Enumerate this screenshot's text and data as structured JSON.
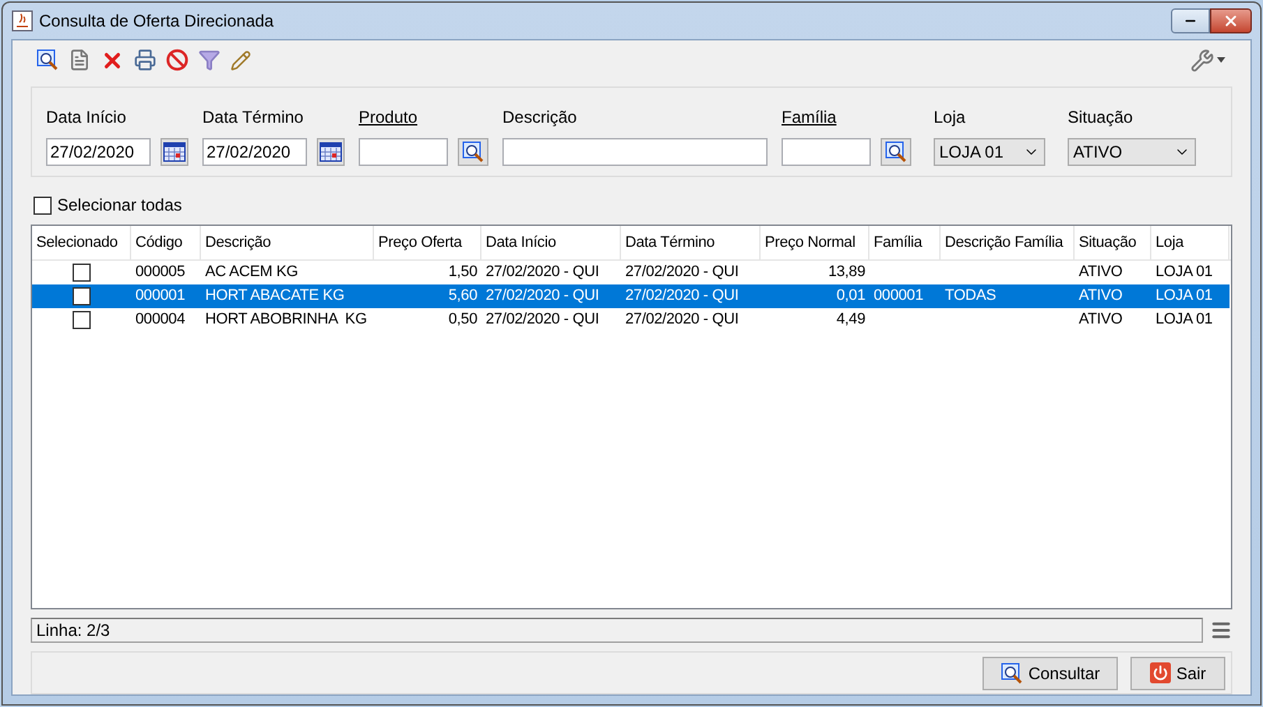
{
  "window": {
    "title": "Consulta de Oferta Direcionada"
  },
  "filters": [
    {
      "kind": "date",
      "label": "Data Início",
      "value": "27/02/2020"
    },
    {
      "kind": "date",
      "label": "Data Término",
      "value": "27/02/2020"
    },
    {
      "kind": "lookup",
      "label": "Produto"
    },
    {
      "kind": "text",
      "label": "Descrição"
    },
    {
      "kind": "lookup",
      "label": "Família"
    },
    {
      "kind": "select",
      "label": "Loja",
      "value": "LOJA 01"
    },
    {
      "kind": "select",
      "label": "Situação",
      "value": "ATIVO"
    }
  ],
  "select_all": {
    "label": "Selecionar todas",
    "checked": false
  },
  "table": {
    "columns": [
      "Selecionado",
      "Código",
      "Descrição",
      "Preço Oferta",
      "Data Início",
      "Data Término",
      "Preço Normal",
      "Família",
      "Descrição Família",
      "Situação",
      "Loja"
    ],
    "rows": [
      {
        "selected": false,
        "checked": false,
        "cells": [
          "",
          "000005",
          "AC ACEM KG",
          "1,50",
          "27/02/2020 - QUI",
          "27/02/2020 - QUI",
          "13,89",
          "",
          "",
          "ATIVO",
          "LOJA 01"
        ]
      },
      {
        "selected": true,
        "checked": false,
        "cells": [
          "",
          "000001",
          "HORT ABACATE KG",
          "5,60",
          "27/02/2020 - QUI",
          "27/02/2020 - QUI",
          "0,01",
          "000001",
          "TODAS",
          "ATIVO",
          "LOJA 01"
        ]
      },
      {
        "selected": false,
        "checked": false,
        "cells": [
          "",
          "000004",
          "HORT ABOBRINHA  KG",
          "0,50",
          "27/02/2020 - QUI",
          "27/02/2020 - QUI",
          "4,49",
          "",
          "",
          "ATIVO",
          "LOJA 01"
        ]
      }
    ]
  },
  "status_bar": {
    "text": "Linha: 2/3"
  },
  "buttons": [
    {
      "kind": "search",
      "label": "Consultar"
    },
    {
      "kind": "exit",
      "label": "Sair"
    }
  ]
}
